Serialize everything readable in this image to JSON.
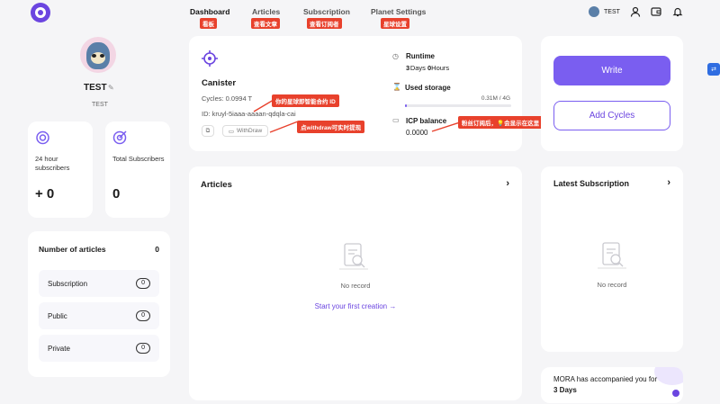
{
  "header": {
    "nav": [
      {
        "label": "Dashboard",
        "annotation": "看板"
      },
      {
        "label": "Articles",
        "annotation": "查看文章"
      },
      {
        "label": "Subscription",
        "annotation": "查看订阅者"
      },
      {
        "label": "Planet Settings",
        "annotation": "星球设置"
      }
    ],
    "username": "TEST"
  },
  "profile": {
    "name": "TEST",
    "handle": "TEST"
  },
  "stats": {
    "subscribers_24h_label": "24 hour subscribers",
    "subscribers_24h_value": "+ 0",
    "total_subscribers_label": "Total Subscribers",
    "total_subscribers_value": "0"
  },
  "articles_count": {
    "title": "Number of articles",
    "total": "0",
    "rows": [
      {
        "label": "Subscription",
        "count": "0"
      },
      {
        "label": "Public",
        "count": "0"
      },
      {
        "label": "Private",
        "count": "0"
      }
    ]
  },
  "canister": {
    "title": "Canister",
    "cycles": "Cycles: 0.0994 T",
    "id": "ID: kruyl-5iaaa-aaaan-qdqla-cai",
    "withdraw_label": "WithDraw",
    "annotation_id": "你的星球即智能合约 ID",
    "annotation_withdraw": "点withdraw可实时提现"
  },
  "runtime": {
    "label": "Runtime",
    "days": "3",
    "days_unit": "Days",
    "hours": "0",
    "hours_unit": "Hours"
  },
  "storage": {
    "label": "Used storage",
    "value": "0.31M / 4G",
    "fraction": 0.0001
  },
  "icp": {
    "label": "ICP balance",
    "value": "0.0000",
    "annotation_before": "粉丝订阅后，",
    "annotation_after": "会显示在这里"
  },
  "actions": {
    "write": "Write",
    "add_cycles": "Add Cycles"
  },
  "articles_panel": {
    "title": "Articles",
    "empty": "No record",
    "cta": "Start your first creation →"
  },
  "latest_subscription": {
    "title": "Latest Subscription",
    "empty": "No record"
  },
  "footer_note": {
    "line1": "MORA has accompanied you for",
    "line2": "3 Days"
  },
  "colors": {
    "accent": "#7a5ef0",
    "annotation": "#e8412c",
    "background": "#f5f5f7"
  }
}
